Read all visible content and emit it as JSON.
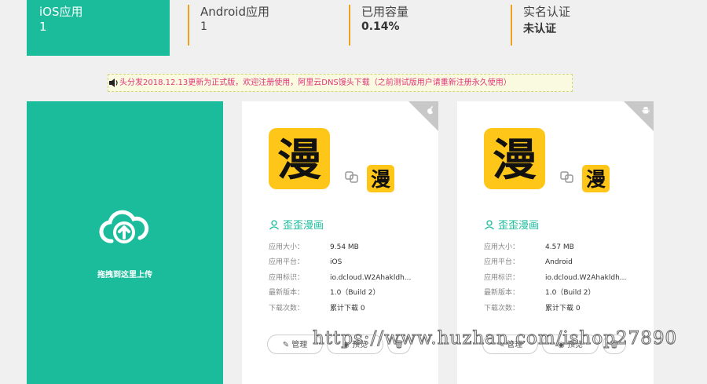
{
  "stats": {
    "ios": {
      "label": "iOS应用",
      "value": "1"
    },
    "android": {
      "label": "Android应用",
      "value": "1"
    },
    "capacity": {
      "label": "已用容量",
      "value": "0.14%"
    },
    "verify": {
      "label": "实名认证",
      "value": "未认证"
    }
  },
  "notice": "头分发2018.12.13更新为正式版，欢迎注册使用，阿里云DNS馒头下载（之前测试版用户请重新注册永久使用）",
  "upload": {
    "label": "拖拽到这里上传"
  },
  "labels": {
    "size": "应用大小：",
    "platform": "应用平台：",
    "bundle": "应用标识：",
    "version": "最新版本：",
    "downloads": "下载次数："
  },
  "cards": [
    {
      "platform_icon": "apple-icon",
      "icon_glyph": "漫",
      "name": "歪歪漫画",
      "size": "9.54 MB",
      "platform": "iOS",
      "bundle": "io.dcloud.W2Ahakldh...",
      "version": "1.0（Build 2）",
      "downloads": "累计下载 0",
      "manage": "管理",
      "preview": "预览"
    },
    {
      "platform_icon": "android-icon",
      "icon_glyph": "漫",
      "name": "歪歪漫画",
      "size": "4.57 MB",
      "platform": "Android",
      "bundle": "io.dcloud.W2Ahakldh...",
      "version": "1.0（Build 2）",
      "downloads": "累计下载 0",
      "manage": "管理",
      "preview": "预览"
    }
  ],
  "watermark": "https://www.huzhan.com/ishop27890",
  "colors": {
    "accent": "#1abc9c",
    "divider": "#f0a020",
    "notice_text": "#e0337a",
    "icon_bg": "#ffc61a"
  }
}
